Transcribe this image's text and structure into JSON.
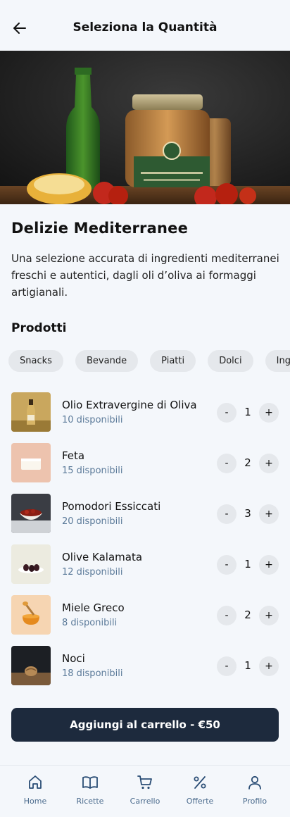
{
  "header": {
    "title": "Seleziona la Quantità"
  },
  "product": {
    "name": "Delizie Mediterranee",
    "description": "Una selezione accurata di ingredienti mediterranei freschi e autentici, dagli oli d’oliva ai formaggi artigianali."
  },
  "section": {
    "title": "Prodotti"
  },
  "categories": [
    "Snacks",
    "Bevande",
    "Piatti",
    "Dolci",
    "Ingredienti"
  ],
  "items": [
    {
      "name": "Olio Extravergine di Oliva",
      "available": "10 disponibili",
      "qty": "1",
      "minus": "-",
      "plus": "+"
    },
    {
      "name": "Feta",
      "available": "15 disponibili",
      "qty": "2",
      "minus": "-",
      "plus": "+"
    },
    {
      "name": "Pomodori Essiccati",
      "available": "20 disponibili",
      "qty": "3",
      "minus": "-",
      "plus": "+"
    },
    {
      "name": "Olive Kalamata",
      "available": "12 disponibili",
      "qty": "1",
      "minus": "-",
      "plus": "+"
    },
    {
      "name": "Miele Greco",
      "available": "8 disponibili",
      "qty": "2",
      "minus": "-",
      "plus": "+"
    },
    {
      "name": "Noci",
      "available": "18 disponibili",
      "qty": "1",
      "minus": "-",
      "plus": "+"
    }
  ],
  "cta": {
    "label": "Aggiungi al carrello - €50"
  },
  "tabbar": {
    "items": [
      {
        "label": "Home",
        "icon": "home-icon"
      },
      {
        "label": "Ricette",
        "icon": "book-icon"
      },
      {
        "label": "Carrello",
        "icon": "cart-icon"
      },
      {
        "label": "Offerte",
        "icon": "percent-icon"
      },
      {
        "label": "Profilo",
        "icon": "user-icon"
      }
    ]
  },
  "colors": {
    "primary": "#1d2a3d",
    "muted": "#5b7a99",
    "chip": "#e5e8ec",
    "background": "#f4f7fb"
  }
}
